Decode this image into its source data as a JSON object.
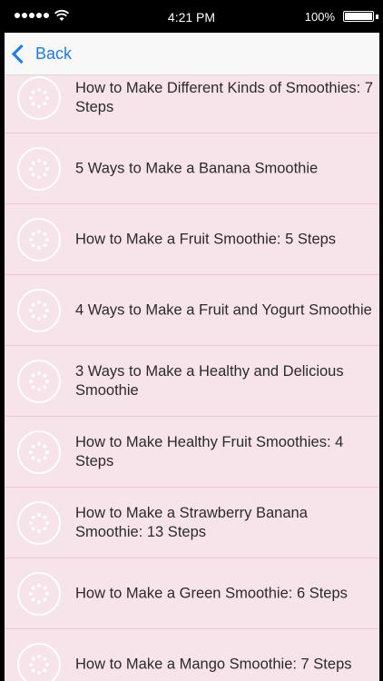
{
  "status_bar": {
    "time": "4:21 PM",
    "battery_percent_label": "100%",
    "battery_level": 1.0,
    "signal_bars": 5
  },
  "nav": {
    "back_label": "Back"
  },
  "items": [
    {
      "label": "How to Make Different Kinds of Smoothies: 7 Steps"
    },
    {
      "label": "5 Ways to Make a Banana Smoothie"
    },
    {
      "label": "How to Make a Fruit Smoothie: 5 Steps"
    },
    {
      "label": "4 Ways to Make a Fruit and Yogurt Smoothie"
    },
    {
      "label": "3 Ways to Make a Healthy and Delicious Smoothie"
    },
    {
      "label": "How to Make Healthy Fruit Smoothies: 4 Steps"
    },
    {
      "label": "How to Make a Strawberry Banana Smoothie: 13 Steps"
    },
    {
      "label": "How to Make a Green Smoothie: 6 Steps"
    },
    {
      "label": "How to Make a Mango Smoothie: 7 Steps"
    }
  ],
  "colors": {
    "accent": "#1a7cf2",
    "row_background": "#f7e3ea",
    "row_divider": "#ecc7d3"
  },
  "icons": {
    "item_thumbnail": "loading-spinner-icon",
    "back": "chevron-left-icon"
  }
}
